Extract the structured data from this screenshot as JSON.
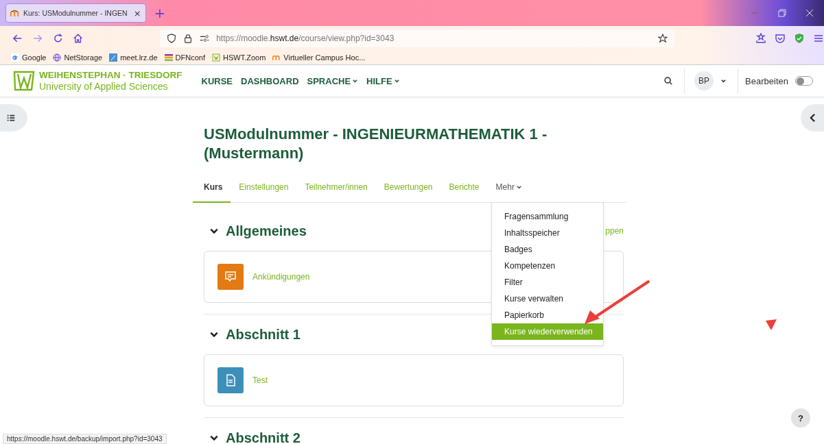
{
  "browser": {
    "tab": {
      "title": "Kurs: USModulnummer - INGEN",
      "close": "×"
    },
    "new_tab": "+",
    "url": {
      "prefix": "https://moodle.",
      "domain": "hswt.de",
      "path": "/course/view.php?id=3043"
    },
    "bookmarks": [
      {
        "label": "Google",
        "kind": "google"
      },
      {
        "label": "NetStorage",
        "kind": "globe"
      },
      {
        "label": "meet.lrz.de",
        "kind": "feather"
      },
      {
        "label": "DFNconf",
        "kind": "stripes"
      },
      {
        "label": "HSWT.Zoom",
        "kind": "logo"
      },
      {
        "label": "Virtueller Campus Hoc...",
        "kind": "moodle"
      }
    ]
  },
  "site": {
    "logo_title": "WEIHENSTEPHAN · TRIESDORF",
    "logo_subtitle": "University of Applied Sciences",
    "nav": [
      {
        "label": "KURSE",
        "dropdown": false
      },
      {
        "label": "DASHBOARD",
        "dropdown": false
      },
      {
        "label": "SPRACHE",
        "dropdown": true
      },
      {
        "label": "HILFE",
        "dropdown": true
      }
    ],
    "user_initials": "BP",
    "edit_label": "Bearbeiten",
    "edit_on": false
  },
  "course": {
    "title": "USModulnummer - INGENIEURMATHEMATIK 1 - (Mustermann)",
    "tabs": [
      {
        "label": "Kurs",
        "selected": true
      },
      {
        "label": "Einstellungen",
        "selected": false
      },
      {
        "label": "Teilnehmer/innen",
        "selected": false
      },
      {
        "label": "Bewertungen",
        "selected": false
      },
      {
        "label": "Berichte",
        "selected": false
      }
    ],
    "more": "Mehr",
    "collapse_all": "ppen",
    "menu": [
      {
        "label": "Fragensammlung",
        "selected": false
      },
      {
        "label": "Inhaltsspeicher",
        "selected": false
      },
      {
        "label": "Badges",
        "selected": false
      },
      {
        "label": "Kompetenzen",
        "selected": false
      },
      {
        "label": "Filter",
        "selected": false
      },
      {
        "label": "Kurse verwalten",
        "selected": false
      },
      {
        "label": "Papierkorb",
        "selected": false
      },
      {
        "label": "Kurse wiederverwenden",
        "selected": true
      }
    ],
    "sections": [
      {
        "title": "Allgemeines",
        "activities": [
          {
            "label": "Ankündigungen",
            "kind": "forum"
          }
        ]
      },
      {
        "title": "Abschnitt 1",
        "activities": [
          {
            "label": "Test",
            "kind": "resource"
          }
        ]
      },
      {
        "title": "Abschnitt 2"
      }
    ]
  },
  "status_url": "https://moodle.hswt.de/backup/import.php?id=3043",
  "help": "?"
}
